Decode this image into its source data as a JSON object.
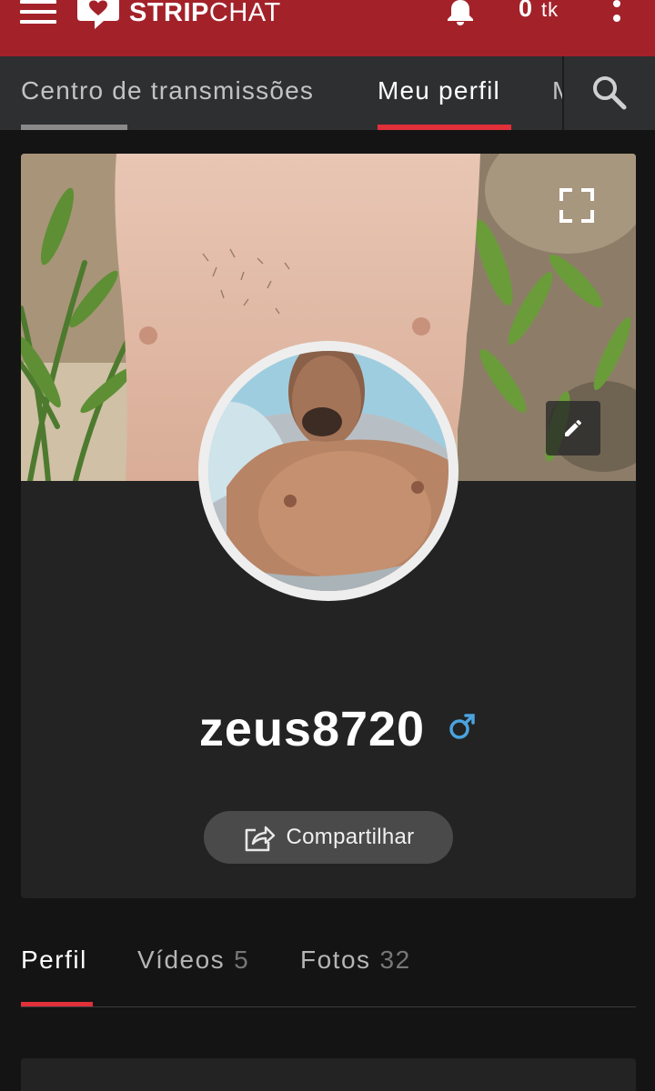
{
  "colors": {
    "brand_red": "#a3222a",
    "nav_bg": "#2d2f31",
    "active_underline": "#e0303a",
    "inactive_underline": "#8a8a8a",
    "male_symbol": "#4aa3df"
  },
  "header": {
    "logo_bold": "STRIP",
    "logo_light": "CHAT",
    "token_balance": "0",
    "token_unit": "tk",
    "icons": [
      "menu-icon",
      "stripchat-logo-icon",
      "bell-icon",
      "kebab-menu-icon"
    ]
  },
  "nav": {
    "tabs": [
      {
        "label": "Centro de transmissões",
        "active": false
      },
      {
        "label": "Meu perfil",
        "active": true
      },
      {
        "label": "M",
        "active": false
      }
    ],
    "search_icon": "search-icon"
  },
  "profile": {
    "username": "zeus8720",
    "gender_icon": "male-symbol-icon",
    "share_label": "Compartilhar",
    "cover_icons": [
      "expand-icon",
      "pencil-icon"
    ]
  },
  "profile_tabs": [
    {
      "label": "Perfil",
      "count": "",
      "active": true
    },
    {
      "label": "Vídeos",
      "count": "5",
      "active": false
    },
    {
      "label": "Fotos",
      "count": "32",
      "active": false
    }
  ]
}
